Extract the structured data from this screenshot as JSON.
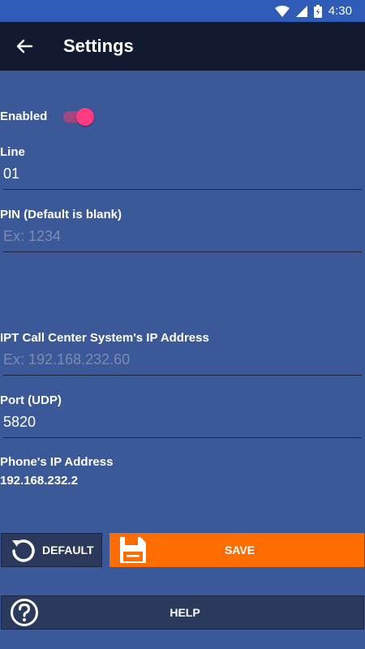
{
  "status_bar": {
    "time": "4:30",
    "icons": [
      "wifi-icon",
      "signal-icon",
      "battery-icon"
    ]
  },
  "app_bar": {
    "title": "Settings",
    "back_icon": "arrow-left-icon"
  },
  "form": {
    "enabled_label": "Enabled",
    "enabled_on": true,
    "line": {
      "label": "Line",
      "value": "01",
      "placeholder": ""
    },
    "pin": {
      "label": "PIN (Default is blank)",
      "value": "",
      "placeholder": "Ex: 1234"
    },
    "ip": {
      "label": "IPT Call Center System's IP Address",
      "value": "",
      "placeholder": "Ex: 192.168.232.60"
    },
    "port": {
      "label": "Port (UDP)",
      "value": "5820",
      "placeholder": ""
    },
    "phone_ip": {
      "label": "Phone's IP Address",
      "value": "192.168.232.2"
    }
  },
  "buttons": {
    "default_label": "DEFAULT",
    "save_label": "SAVE",
    "help_label": "HELP"
  },
  "colors": {
    "background": "#3b5998",
    "app_bar": "#121a30",
    "status_bar": "#2f5cb6",
    "accent_switch": "#ff3b82",
    "save_button": "#ff6d00",
    "dark_button": "#2b3a5c"
  }
}
